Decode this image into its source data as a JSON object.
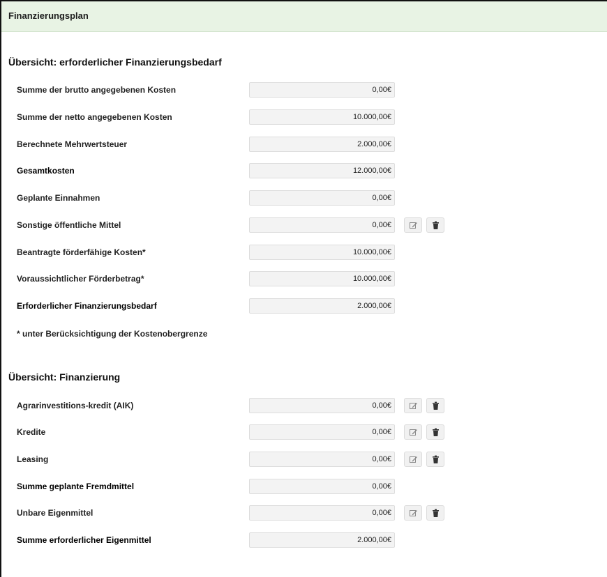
{
  "panel": {
    "title": "Finanzierungsplan"
  },
  "bedarf": {
    "title": "Übersicht: erforderlicher Finanzierungsbedarf",
    "rows": [
      {
        "label": "Summe der brutto angegebenen Kosten",
        "value": "0,00€"
      },
      {
        "label": "Summe der netto angegebenen Kosten",
        "value": "10.000,00€"
      },
      {
        "label": "Berechnete Mehrwertsteuer",
        "value": "2.000,00€"
      },
      {
        "label": "Gesamtkosten",
        "value": "12.000,00€"
      },
      {
        "label": "Geplante Einnahmen",
        "value": "0,00€"
      },
      {
        "label": "Sonstige öffentliche Mittel",
        "value": "0,00€"
      },
      {
        "label": "Beantragte förderfähige Kosten*",
        "value": "10.000,00€"
      },
      {
        "label": "Voraussichtlicher Förderbetrag*",
        "value": "10.000,00€"
      },
      {
        "label": "Erforderlicher Finanzierungsbedarf",
        "value": "2.000,00€"
      }
    ],
    "footnote": "* unter Berücksichtigung der Kostenobergrenze"
  },
  "finanzierung": {
    "title": "Übersicht: Finanzierung",
    "rows": [
      {
        "label": "Agrarinvestitions-kredit (AIK)",
        "value": "0,00€"
      },
      {
        "label": "Kredite",
        "value": "0,00€"
      },
      {
        "label": "Leasing",
        "value": "0,00€"
      },
      {
        "label": "Summe geplante Fremdmittel",
        "value": "0,00€"
      },
      {
        "label": "Unbare Eigenmittel",
        "value": "0,00€"
      },
      {
        "label": "Summe erforderlicher Eigenmittel",
        "value": "2.000,00€"
      }
    ]
  },
  "icons": {
    "edit": "edit-icon",
    "delete": "trash-icon"
  },
  "colors": {
    "header_bg": "#e8f3e4",
    "field_bg": "#f3f3f3"
  }
}
